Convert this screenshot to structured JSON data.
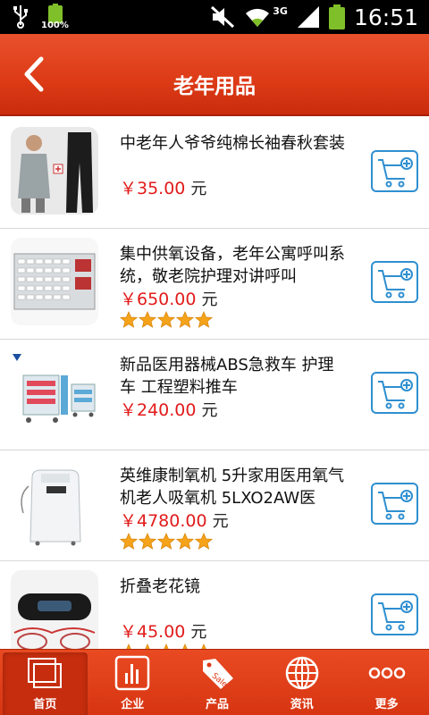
{
  "status_bar": {
    "battery_small_label": "100%",
    "network": "3G",
    "time": "16:51",
    "icons": [
      "usb-icon",
      "battery-icon",
      "mute-icon",
      "wifi-icon",
      "signal-icon",
      "battery-icon"
    ]
  },
  "header": {
    "title": "老年用品",
    "back_icon": "chevron-left-icon"
  },
  "colors": {
    "header": "#dd3a16",
    "price": "#e21b1b",
    "cart_border": "#2f8fd0",
    "star": "#f5a31a"
  },
  "products": [
    {
      "name": "中老年人爷爷纯棉长袖春秋套装",
      "price": "￥35.00",
      "unit": "元",
      "rating": 0
    },
    {
      "name": "集中供氧设备，老年公寓呼叫系统，敬老院护理对讲呼叫",
      "price": "￥650.00",
      "unit": "元",
      "rating": 5
    },
    {
      "name": "新品医用器械ABS急救车 护理车 工程塑料推车",
      "price": "￥240.00",
      "unit": "元",
      "rating": 0
    },
    {
      "name": "英维康制氧机 5升家用医用氧气机老人吸氧机 5LXO2AW医",
      "price": "￥4780.00",
      "unit": "元",
      "rating": 5
    },
    {
      "name": "折叠老花镜",
      "price": "￥45.00",
      "unit": "元",
      "rating": 5
    }
  ],
  "bottom_nav": [
    {
      "label": "首页",
      "icon": "home-icon",
      "active": true
    },
    {
      "label": "企业",
      "icon": "chart-icon",
      "active": false
    },
    {
      "label": "产品",
      "icon": "sale-tag-icon",
      "active": false
    },
    {
      "label": "资讯",
      "icon": "globe-icon",
      "active": false
    },
    {
      "label": "更多",
      "icon": "more-icon",
      "active": false
    }
  ]
}
